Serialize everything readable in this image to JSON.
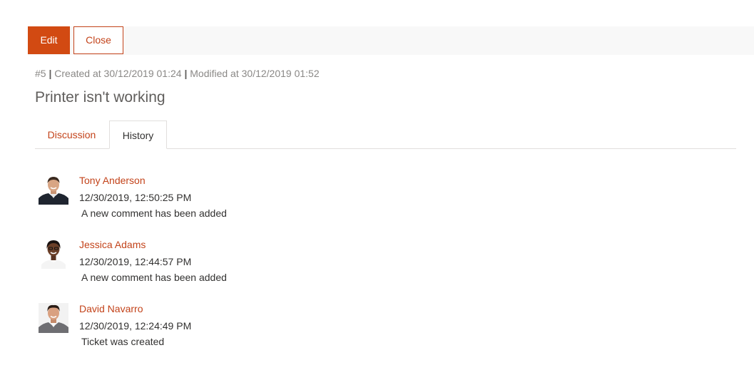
{
  "toolbar": {
    "edit_label": "Edit",
    "close_label": "Close"
  },
  "ticket": {
    "id": "#5",
    "created_text": "Created at 30/12/2019 01:24",
    "modified_text": "Modified at 30/12/2019 01:52",
    "title": "Printer isn't working"
  },
  "tabs": [
    {
      "label": "Discussion",
      "active": false
    },
    {
      "label": "History",
      "active": true
    }
  ],
  "history": [
    {
      "author": "Tony Anderson",
      "time": "12/30/2019, 12:50:25 PM",
      "description": "A new comment has been added"
    },
    {
      "author": "Jessica Adams",
      "time": "12/30/2019, 12:44:57 PM",
      "description": "A new comment has been added"
    },
    {
      "author": "David Navarro",
      "time": "12/30/2019, 12:24:49 PM",
      "description": "Ticket was created"
    }
  ],
  "colors": {
    "accent": "#d24a12",
    "link": "#c3431a",
    "muted_text": "#8a8886",
    "toolbar_bg": "#f8f8f8"
  }
}
